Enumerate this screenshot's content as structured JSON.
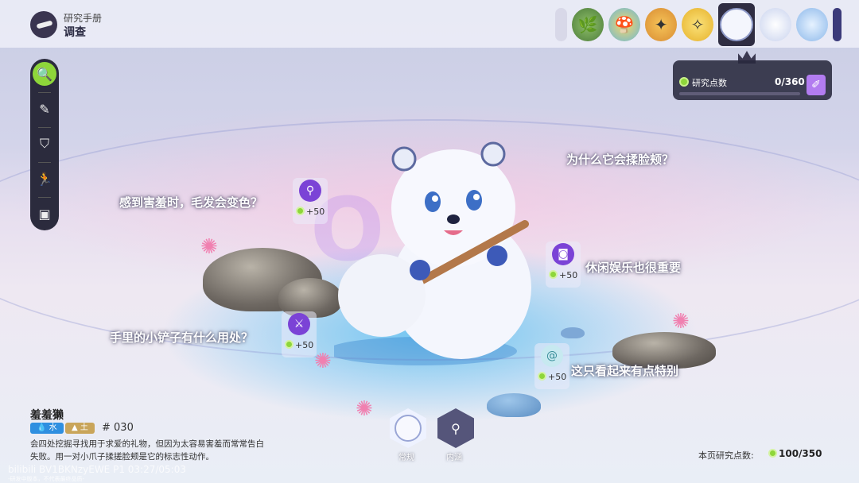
{
  "header": {
    "breadcrumb_parent": "研究手册",
    "breadcrumb_current": "调查"
  },
  "creature_strip": {
    "items": [
      {
        "icon": "partial-thumbnail"
      },
      {
        "icon": "leaf-creature-icon"
      },
      {
        "icon": "mushroom-creature-icon"
      },
      {
        "icon": "golden-creature-icon"
      },
      {
        "icon": "yellow-creature-icon"
      },
      {
        "icon": "otter-creature-icon",
        "selected": true
      },
      {
        "icon": "white-creature-icon"
      },
      {
        "icon": "blue-creature-icon"
      },
      {
        "icon": "partial-thumbnail"
      }
    ]
  },
  "sidebar": {
    "items": [
      {
        "icon": "search-book-icon",
        "active": true
      },
      {
        "icon": "notes-icon"
      },
      {
        "icon": "shield-icon"
      },
      {
        "icon": "running-figure-icon"
      },
      {
        "icon": "picture-icon"
      }
    ]
  },
  "research": {
    "label": "研究点数",
    "value": "0/360",
    "progress": 0,
    "action_icon": "brush-icon"
  },
  "questions": [
    {
      "text": "感到害羞时，毛发会变色？",
      "reward": "+50",
      "icon": "magnifier-icon"
    },
    {
      "text": "为什么它会揉脸颊？",
      "reward": "",
      "icon": ""
    },
    {
      "text": "休闲娱乐也很重要",
      "reward": "+50",
      "icon": "camera-icon"
    },
    {
      "text": "手里的小铲子有什么用处？",
      "reward": "+50",
      "icon": "crossed-swords-icon"
    },
    {
      "text": "这只看起来有点特别",
      "reward": "+50",
      "icon": "swirl-icon"
    }
  ],
  "creature": {
    "name": "羞羞獭",
    "element_1": "水",
    "element_2": "土",
    "number": "# 030",
    "description": "会四处挖掘寻找用于求爱的礼物，但因为太容易害羞而常常告白失败。用一对小爪子揉搓脸颊是它的标志性动作。"
  },
  "modes": {
    "normal": "常规",
    "detail": "内涵"
  },
  "page_points": {
    "label": "本页研究点数:",
    "value": "100/350"
  },
  "overlay": {
    "watermark": "bilibili BV1BKNzyEWE P1 03:27/05:03",
    "disclaimer": "-研发中版本，不代表最终品质-"
  },
  "colors": {
    "accent_green": "#8ed63a",
    "accent_purple": "#7b43d6",
    "water_tag": "#2f8fe0",
    "earth_tag": "#c9a55a",
    "dark_panel": "#2b2b3d"
  }
}
